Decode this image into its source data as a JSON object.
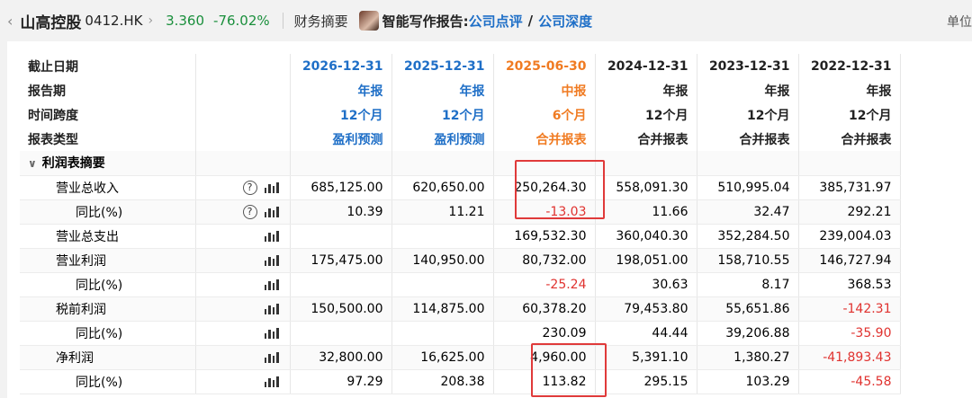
{
  "header": {
    "back_icon": "‹",
    "stock_name": "山高控股",
    "stock_code": "0412.HK",
    "chevron": "›",
    "price": "3.360",
    "change": "-76.02%",
    "financial_summary": "财务摘要",
    "ai_label": "智能写作报告:",
    "link_review": "公司点评",
    "separator": "/",
    "link_depth": "公司深度",
    "unit": "单位"
  },
  "table": {
    "header_rows": [
      {
        "label": "截止日期",
        "values": [
          "2026-12-31",
          "2025-12-31",
          "2025-06-30",
          "2024-12-31",
          "2023-12-31",
          "2022-12-31"
        ]
      },
      {
        "label": "报告期",
        "values": [
          "年报",
          "年报",
          "中报",
          "年报",
          "年报",
          "年报"
        ]
      },
      {
        "label": "时间跨度",
        "values": [
          "12个月",
          "12个月",
          "6个月",
          "12个月",
          "12个月",
          "12个月"
        ]
      },
      {
        "label": "报表类型",
        "values": [
          "盈利预测",
          "盈利预测",
          "合并报表",
          "合并报表",
          "合并报表",
          "合并报表"
        ]
      }
    ],
    "section_title": "利润表摘要",
    "section_caret": "∨",
    "rows": [
      {
        "label": "营业总收入",
        "values": [
          "685,125.00",
          "620,650.00",
          "250,264.30",
          "558,091.30",
          "510,995.04",
          "385,731.97"
        ]
      },
      {
        "label": "同比(%)",
        "values": [
          "10.39",
          "11.21",
          "-13.03",
          "11.66",
          "32.47",
          "292.21"
        ]
      },
      {
        "label": "营业总支出",
        "values": [
          "",
          "",
          "169,532.30",
          "360,040.30",
          "352,284.50",
          "239,004.03"
        ]
      },
      {
        "label": "营业利润",
        "values": [
          "175,475.00",
          "140,950.00",
          "80,732.00",
          "198,051.00",
          "158,710.55",
          "146,727.94"
        ]
      },
      {
        "label": "同比(%)",
        "values": [
          "",
          "",
          "-25.24",
          "30.63",
          "8.17",
          "368.53"
        ]
      },
      {
        "label": "税前利润",
        "values": [
          "150,500.00",
          "114,875.00",
          "60,378.20",
          "79,453.80",
          "55,651.86",
          "-142.31"
        ]
      },
      {
        "label": "同比(%)",
        "values": [
          "",
          "",
          "230.09",
          "44.44",
          "39,206.88",
          "-35.90"
        ]
      },
      {
        "label": "净利润",
        "values": [
          "32,800.00",
          "16,625.00",
          "4,960.00",
          "5,391.10",
          "1,380.27",
          "-41,893.43"
        ]
      },
      {
        "label": "同比(%)",
        "values": [
          "97.29",
          "208.38",
          "113.82",
          "295.15",
          "103.29",
          "-45.58"
        ]
      }
    ],
    "help_icon": "?"
  },
  "colors": {
    "up_green": "#1a8f3c",
    "forecast_blue": "#1f6fc7",
    "current_orange": "#f07b22",
    "negative_red": "#e0322f",
    "highlight_red": "#e03a3a"
  }
}
